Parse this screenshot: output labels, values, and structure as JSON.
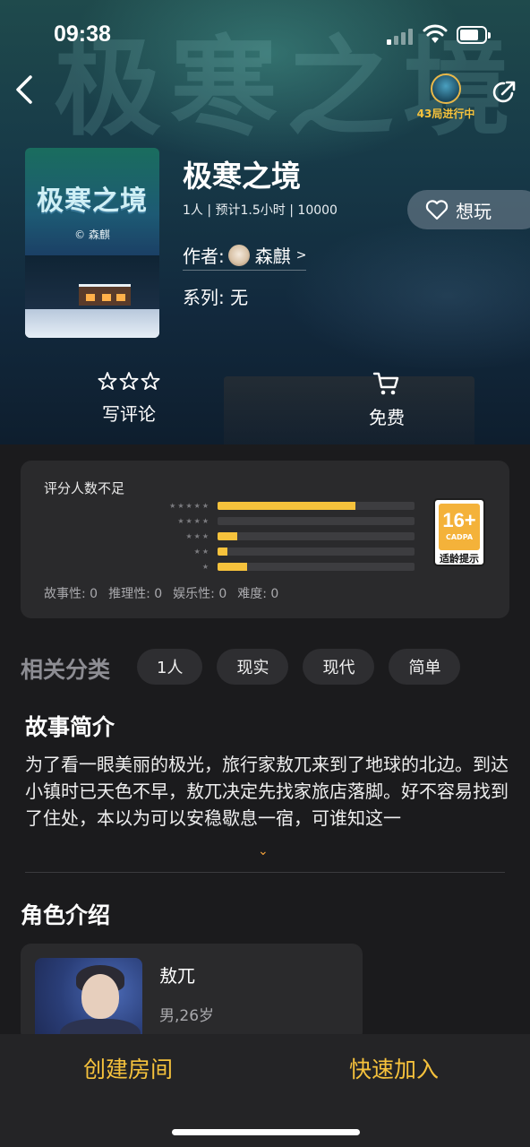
{
  "status_bar": {
    "time": "09:38"
  },
  "hero": {
    "bg_title": "极寒之境",
    "game_badge": {
      "text": "43局进行中"
    },
    "cover": {
      "title": "极寒之境",
      "author": "© 森麒"
    },
    "title": "极寒之境",
    "meta": "1人 | 预计1.5小时 | 10000",
    "author_label": "作者:",
    "author_name": "森麒",
    "author_chevron": ">",
    "series": "系列: 无",
    "want_label": "想玩",
    "actions": [
      {
        "label": "写评论",
        "icon": "three-stars-icon"
      },
      {
        "label": "免费",
        "icon": "cart-icon"
      }
    ]
  },
  "rating": {
    "header": "评分人数不足",
    "rows": [
      {
        "stars": "★★★★★",
        "fraction": 0.7
      },
      {
        "stars": "★★★★",
        "fraction": 0.0
      },
      {
        "stars": "★★★",
        "fraction": 0.1
      },
      {
        "stars": "★★",
        "fraction": 0.05
      },
      {
        "stars": "★",
        "fraction": 0.15
      }
    ],
    "age": {
      "big": "16+",
      "small": "CADPA",
      "note": "适龄提示"
    },
    "metrics": [
      "故事性: 0",
      "推理性: 0",
      "娱乐性: 0",
      "难度: 0"
    ]
  },
  "categories": {
    "title": "相关分类",
    "chips": [
      "1人",
      "现实",
      "现代",
      "简单"
    ]
  },
  "story": {
    "title": "故事简介",
    "text": "为了看一眼美丽的极光，旅行家敖兀来到了地球的北边。到达小镇时已天色不早，敖兀决定先找家旅店落脚。好不容易找到了住处，本以为可以安稳歇息一宿，可谁知这一",
    "expand": "⌄"
  },
  "characters": {
    "title": "角色介绍",
    "items": [
      {
        "name": "敖兀",
        "info": "男,26岁"
      }
    ]
  },
  "bottom_bar": {
    "create": "创建房间",
    "join": "快速加入"
  },
  "colors": {
    "accent": "#f6c23c",
    "bg": "#1b1b1d",
    "card": "#2a2a2c"
  }
}
